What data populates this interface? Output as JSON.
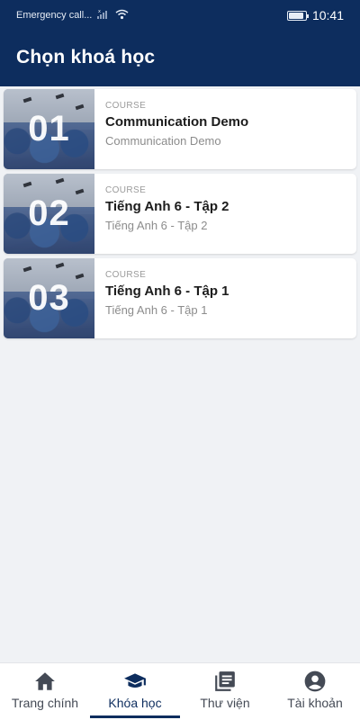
{
  "status_bar": {
    "carrier": "Emergency call...",
    "time": "10:41",
    "battery_level": 0.9
  },
  "app_bar": {
    "title": "Chọn khoá học"
  },
  "courses": [
    {
      "number": "01",
      "type": "COURSE",
      "title": "Communication Demo",
      "subtitle": "Communication Demo"
    },
    {
      "number": "02",
      "type": "COURSE",
      "title": "Tiếng Anh 6 - Tập 2",
      "subtitle": "Tiếng Anh 6 - Tập 2"
    },
    {
      "number": "03",
      "type": "COURSE",
      "title": "Tiếng Anh 6 - Tập 1",
      "subtitle": "Tiếng Anh 6 - Tập 1"
    }
  ],
  "bottom_nav": {
    "items": [
      {
        "label": "Trang chính",
        "icon": "home-icon",
        "active": false
      },
      {
        "label": "Khóa học",
        "icon": "graduation-cap-icon",
        "active": true
      },
      {
        "label": "Thư viện",
        "icon": "library-icon",
        "active": false
      },
      {
        "label": "Tài khoản",
        "icon": "account-icon",
        "active": false
      }
    ]
  },
  "colors": {
    "primary": "#0d2d5e",
    "background": "#f0f2f5",
    "nav_inactive": "#444a55"
  }
}
